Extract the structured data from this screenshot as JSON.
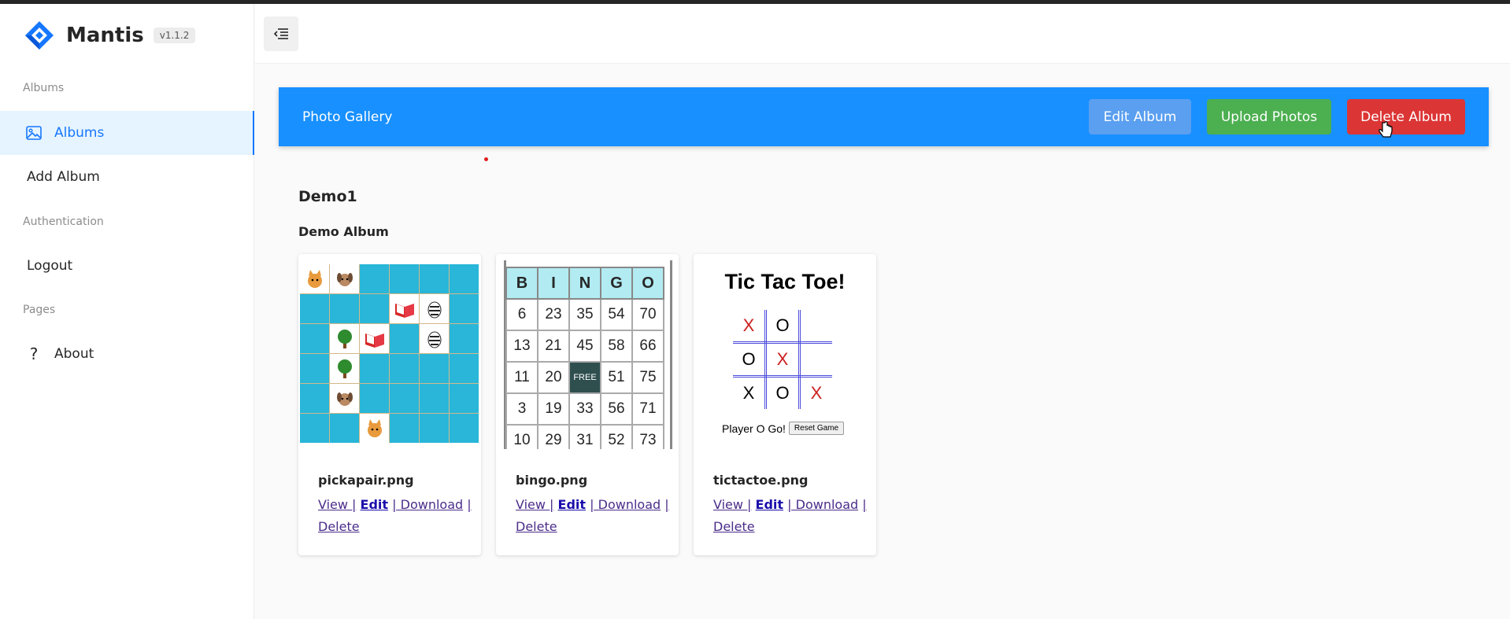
{
  "app": {
    "name": "Mantis",
    "version": "v1.1.2"
  },
  "sidebar": {
    "groups": [
      {
        "label": "Albums",
        "items": [
          {
            "label": "Albums",
            "icon": "image-icon",
            "active": true
          },
          {
            "label": "Add Album",
            "icon": ""
          }
        ]
      },
      {
        "label": "Authentication",
        "items": [
          {
            "label": "Logout",
            "icon": ""
          }
        ]
      },
      {
        "label": "Pages",
        "items": [
          {
            "label": "About",
            "icon": "question-icon"
          }
        ]
      }
    ]
  },
  "gallery": {
    "title": "Photo Gallery",
    "buttons": {
      "edit": "Edit Album",
      "upload": "Upload Photos",
      "delete": "Delete Album"
    }
  },
  "album": {
    "name": "Demo1",
    "description": "Demo Album"
  },
  "photos": [
    {
      "file": "pickapair.png",
      "links": {
        "view": "View |",
        "edit": "Edit",
        "download": "| Download",
        "delete": "| Delete"
      }
    },
    {
      "file": "bingo.png",
      "links": {
        "view": "View |",
        "edit": "Edit",
        "download": "| Download",
        "delete": "| Delete"
      }
    },
    {
      "file": "tictactoe.png",
      "links": {
        "view": "View |",
        "edit": "Edit",
        "download": "| Download",
        "delete": "| Delete"
      }
    }
  ],
  "bingo": {
    "header": [
      "B",
      "I",
      "N",
      "G",
      "O"
    ],
    "rows": [
      [
        "6",
        "23",
        "35",
        "54",
        "70"
      ],
      [
        "13",
        "21",
        "45",
        "58",
        "66"
      ],
      [
        "11",
        "20",
        "FREE",
        "51",
        "75"
      ],
      [
        "3",
        "19",
        "33",
        "56",
        "71"
      ],
      [
        "10",
        "29",
        "31",
        "52",
        "73"
      ]
    ]
  },
  "tictactoe": {
    "title": "Tic Tac Toe!",
    "cells": [
      [
        "X",
        "O",
        ""
      ],
      [
        "O",
        "X",
        ""
      ],
      [
        "X",
        "O",
        "X"
      ]
    ],
    "status": "Player O Go!",
    "reset": "Reset Game"
  },
  "colors": {
    "primary": "#1890ff",
    "success": "#4caf50",
    "danger": "#dc3535",
    "editBtn": "#5a9ff0"
  }
}
